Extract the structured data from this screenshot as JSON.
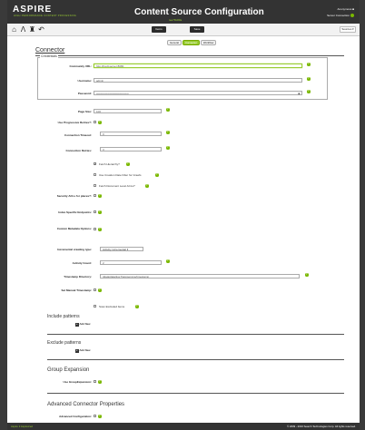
{
  "header": {
    "logo": "ASPIRE",
    "logo_sub": "HIGH PERFORMANCE CONTENT PROCESSING",
    "title": "Content Source Configuration",
    "subtitle": "tee7f0d9fa",
    "user": "Anonymous",
    "status": "Server Connection"
  },
  "toolbar": {
    "items_label": "Items",
    "save_label": "Save",
    "sources_label": "Sources ▾"
  },
  "tabs": [
    "General",
    "Connector",
    "Workflow"
  ],
  "connector": {
    "title": "Connector",
    "credentials_legend": "Credentials",
    "community_url_label": "Community URL:",
    "community_url_value": "http://lsvdl-server:8080",
    "username_label": "Username:",
    "username_value": "admin",
    "password_label": "Password:",
    "password_value": "••••••••••••••••••••••••••••••••••",
    "page_size_label": "Page Size:",
    "page_size_value": "100",
    "progressive_label": "Use Progressive Retries?:",
    "conn_timeout_label": "Connection Timeout:",
    "conn_timeout_value": "0",
    "conn_retries_label": "Connection Retries:",
    "conn_retries_value": "3",
    "fetch_hierarchy": "Fetch Hierarchy?",
    "creation_filter": "Use Creation Date Filter for Crawls",
    "fetch_acls": "Fetch Document Level ACLs?",
    "security_acls_label": "Security ACLs for places?:",
    "index_endpoints_label": "Index Specific Endpoints:",
    "custom_metadata_label": "Custom Metadata Options:",
    "incremental_type_label": "Incremental crawling type:",
    "incremental_type_value": "Activity incremental",
    "activity_count_label": "Activity Count:",
    "activity_count_value": "2",
    "timestamp_dir_label": "Timestamp Directory:",
    "timestamp_dir_value": "/jdata/data/jiveT/appservice/timestamp",
    "manual_timestamp_label": "Set Manual Timestamp:",
    "scan_excluded": "Scan Excluded Items",
    "include_patterns": "Include patterns",
    "exclude_patterns": "Exclude patterns",
    "add_new": "Add New"
  },
  "group_expansion": {
    "title": "Group Expansion",
    "use_label": "Use GroupExpansion:"
  },
  "advanced": {
    "title": "Advanced Connector Properties",
    "config_label": "Advanced Configuration:"
  },
  "footer": {
    "left": "Aspire 3 Aspireized",
    "right": "© 2009 - 2016 Search Technologies Corp. All rights reserved."
  },
  "colors": {
    "accent": "#7ab800",
    "header_bg": "#333333"
  },
  "icons": [
    "home-icon",
    "tree-icon",
    "tower-icon",
    "back-icon",
    "help-icon",
    "eye-icon",
    "plus-icon",
    "user-icon"
  ]
}
